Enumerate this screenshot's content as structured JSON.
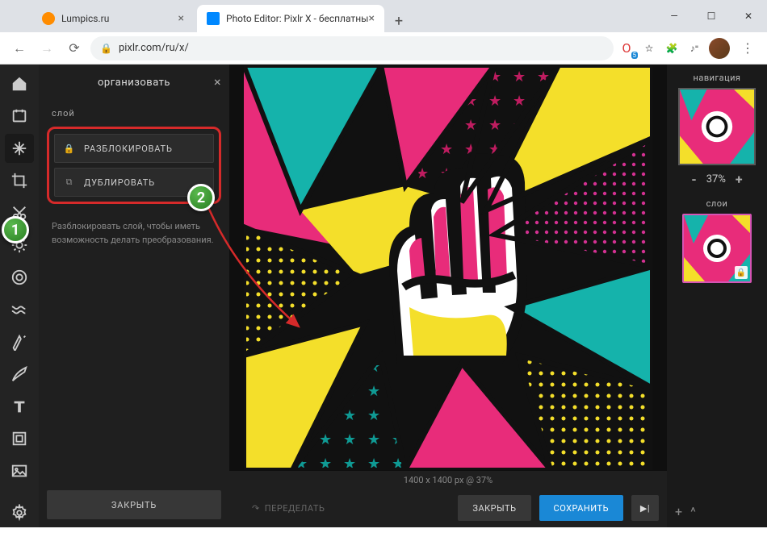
{
  "browser": {
    "tabs": [
      {
        "title": "Lumpics.ru"
      },
      {
        "title": "Photo Editor: Pixlr X - бесплатны"
      }
    ],
    "url": "pixlr.com/ru/x/",
    "window_controls": {
      "minimize": "—",
      "maximize": "☐",
      "close": "✕"
    }
  },
  "ext_badge": "5",
  "panel": {
    "title": "организовать",
    "section_label": "слой",
    "unlock_label": "РАЗБЛОКИРОВАТЬ",
    "duplicate_label": "ДУБЛИРОВАТЬ",
    "help_text": "Разблокировать слой, чтобы иметь возможность делать преобразования.",
    "close_label": "ЗАКРЫТЬ"
  },
  "canvas": {
    "status": "1400 x 1400 px @ 37%",
    "redo_label": "ПЕРЕДЕЛАТЬ",
    "close_label": "ЗАКРЫТЬ",
    "save_label": "СОХРАНИТЬ"
  },
  "right": {
    "nav_label": "навигация",
    "zoom_minus": "-",
    "zoom_value": "37%",
    "zoom_plus": "+",
    "layers_label": "слои",
    "footer_plus": "+",
    "footer_chevron": "^"
  },
  "markers": {
    "one": "1",
    "two": "2"
  }
}
